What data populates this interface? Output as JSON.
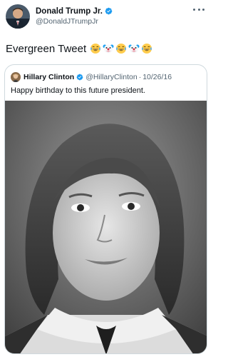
{
  "tweet": {
    "author": {
      "display_name": "Donald Trump Jr.",
      "handle": "@DonaldJTrumpJr",
      "avatar_icon": "profile-photo",
      "verified_icon": "verified-badge-icon"
    },
    "menu_icon": "more-options-icon",
    "text": "Evergreen Tweet",
    "emojis": [
      "laughing-crying-emoji",
      "clown-face-emoji",
      "laughing-crying-emoji",
      "clown-face-emoji",
      "laughing-crying-emoji"
    ]
  },
  "quoted_tweet": {
    "author": {
      "display_name": "Hillary Clinton",
      "handle": "@HillaryClinton",
      "avatar_icon": "profile-photo",
      "verified_icon": "verified-badge-icon"
    },
    "separator": "·",
    "date": "10/26/16",
    "text": "Happy birthday to this future president.",
    "media": "black-and-white-portrait-photo"
  },
  "colors": {
    "verified_blue": "#1d9bf0",
    "secondary_text": "#536471",
    "border": "#cfd9de",
    "primary_text": "#0f1419"
  }
}
